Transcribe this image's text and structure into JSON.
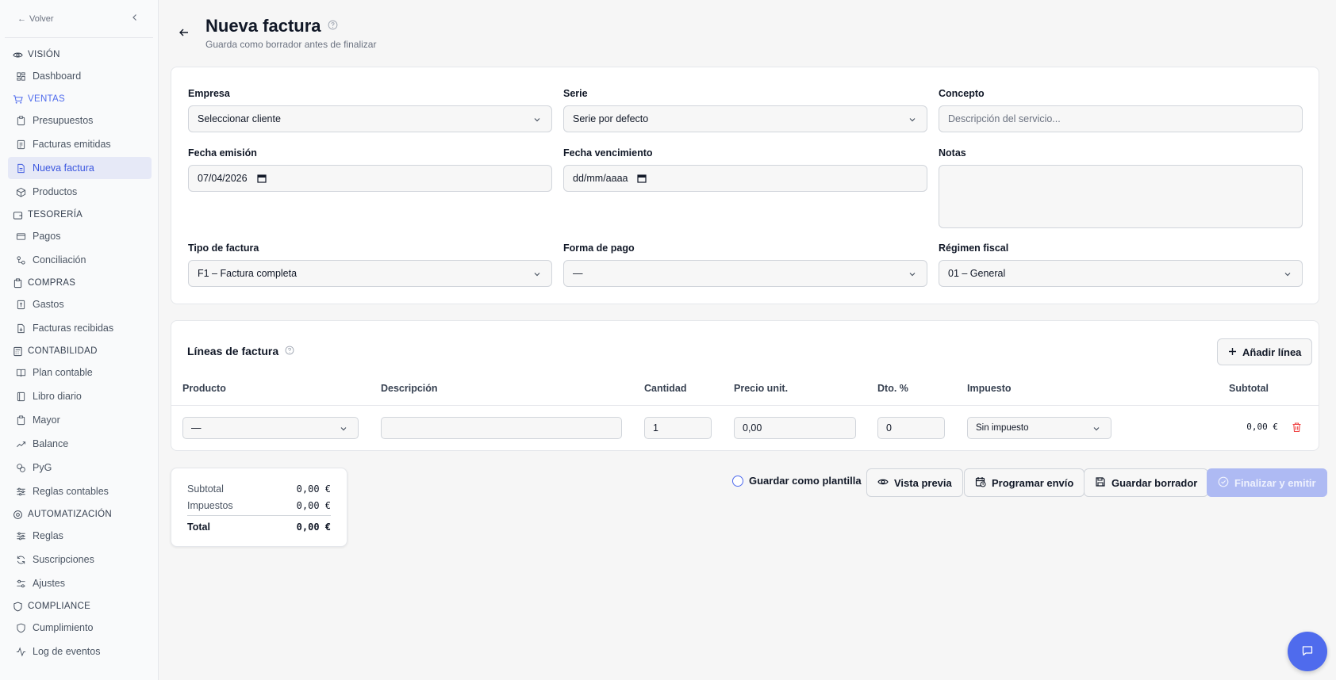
{
  "sidebar": {
    "back_label": "Volver",
    "sections": [
      {
        "label": "VISIÓN",
        "icon": "eye-icon",
        "items": [
          {
            "label": "Dashboard",
            "icon": "dashboard-icon"
          }
        ]
      },
      {
        "label": "VENTAS",
        "icon": "cart-icon",
        "active": true,
        "items": [
          {
            "label": "Presupuestos",
            "icon": "clipboard-icon"
          },
          {
            "label": "Facturas emitidas",
            "icon": "invoice-icon"
          },
          {
            "label": "Nueva factura",
            "icon": "document-icon",
            "active": true
          },
          {
            "label": "Productos",
            "icon": "package-icon"
          }
        ]
      },
      {
        "label": "TESORERÍA",
        "icon": "wallet-icon",
        "items": [
          {
            "label": "Pagos",
            "icon": "card-icon"
          },
          {
            "label": "Conciliación",
            "icon": "link-icon"
          }
        ]
      },
      {
        "label": "COMPRAS",
        "icon": "clipboard-icon",
        "items": [
          {
            "label": "Gastos",
            "icon": "receipt-icon"
          },
          {
            "label": "Facturas recibidas",
            "icon": "file-icon"
          }
        ]
      },
      {
        "label": "CONTABILIDAD",
        "icon": "calculator-icon",
        "items": [
          {
            "label": "Plan contable",
            "icon": "book-icon"
          },
          {
            "label": "Libro diario",
            "icon": "notebook-icon"
          },
          {
            "label": "Mayor",
            "icon": "clipboard-icon"
          },
          {
            "label": "Balance",
            "icon": "trend-icon"
          },
          {
            "label": "PyG",
            "icon": "coins-icon"
          },
          {
            "label": "Reglas contables",
            "icon": "sliders-icon"
          }
        ]
      },
      {
        "label": "AUTOMATIZACIÓN",
        "icon": "bot-icon",
        "items": [
          {
            "label": "Reglas",
            "icon": "sliders-icon"
          },
          {
            "label": "Suscripciones",
            "icon": "refresh-icon"
          },
          {
            "label": "Ajustes",
            "icon": "settings-icon"
          }
        ]
      },
      {
        "label": "COMPLIANCE",
        "icon": "shield-icon",
        "items": [
          {
            "label": "Cumplimiento",
            "icon": "shield-icon"
          },
          {
            "label": "Log de eventos",
            "icon": "activity-icon"
          }
        ]
      }
    ]
  },
  "header": {
    "title": "Nueva factura",
    "subtitle": "Guarda como borrador antes de finalizar"
  },
  "form": {
    "empresa": {
      "label": "Empresa",
      "value": "Seleccionar cliente"
    },
    "serie": {
      "label": "Serie",
      "value": "Serie por defecto"
    },
    "concepto": {
      "label": "Concepto",
      "placeholder": "Descripción del servicio..."
    },
    "fecha_emision": {
      "label": "Fecha emisión",
      "value": "07/04/2026"
    },
    "fecha_vencimiento": {
      "label": "Fecha vencimiento",
      "value": "dd/mm/aaaa"
    },
    "notas": {
      "label": "Notas"
    },
    "tipo_factura": {
      "label": "Tipo de factura",
      "value": "F1 – Factura completa"
    },
    "forma_pago": {
      "label": "Forma de pago",
      "value": "—"
    },
    "regimen_fiscal": {
      "label": "Régimen fiscal",
      "value": "01 – General"
    }
  },
  "lines": {
    "title": "Líneas de factura",
    "add_label": "Añadir línea",
    "columns": [
      "Producto",
      "Descripción",
      "Cantidad",
      "Precio unit.",
      "Dto. %",
      "Impuesto",
      "Subtotal"
    ],
    "rows": [
      {
        "producto": "—",
        "descripcion": "",
        "cantidad": "1",
        "precio": "0,00",
        "dto": "0",
        "impuesto": "Sin impuesto",
        "subtotal": "0,00 €"
      }
    ]
  },
  "totals": {
    "subtotal_label": "Subtotal",
    "subtotal": "0,00 €",
    "impuestos_label": "Impuestos",
    "impuestos": "0,00 €",
    "total_label": "Total",
    "total": "0,00 €"
  },
  "actions": {
    "template_label": "Guardar como plantilla",
    "preview_label": "Vista previa",
    "schedule_label": "Programar envío",
    "draft_label": "Guardar borrador",
    "finalize_label": "Finalizar y emitir"
  },
  "colors": {
    "accent": "#4f6bed",
    "active_bg": "#e6e9f7",
    "primary_disabled": "#aebaf3",
    "danger": "#ef4444"
  }
}
